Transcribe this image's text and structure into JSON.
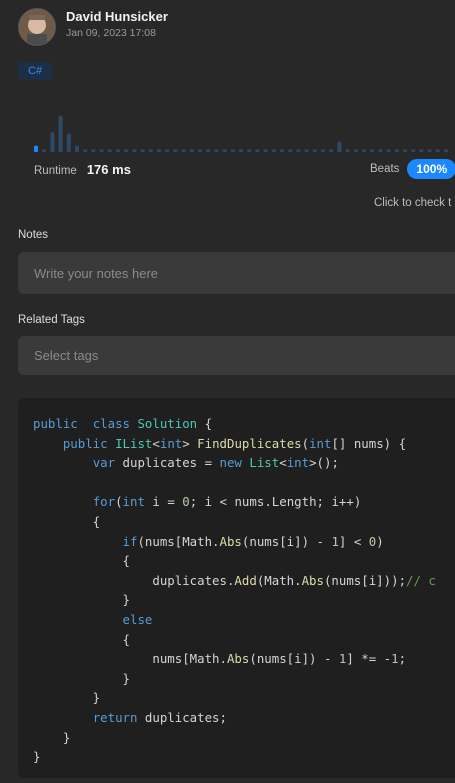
{
  "author": {
    "name": "David Hunsicker",
    "date": "Jan 09, 2023 17:08"
  },
  "language": "C#",
  "histogram": {
    "bar_heights": [
      0.12,
      0.05,
      0.38,
      0.7,
      0.35,
      0.12,
      0.05,
      0.05,
      0.05,
      0.05,
      0.05,
      0.05,
      0.05,
      0.05,
      0.05,
      0.05,
      0.05,
      0.05,
      0.05,
      0.05,
      0.05,
      0.05,
      0.05,
      0.05,
      0.05,
      0.05,
      0.05,
      0.05,
      0.05,
      0.05,
      0.05,
      0.05,
      0.05,
      0.05,
      0.05,
      0.05,
      0.05,
      0.2,
      0.05,
      0.05,
      0.05,
      0.05,
      0.05,
      0.05,
      0.05,
      0.05,
      0.05,
      0.05,
      0.05,
      0.05,
      0.05
    ],
    "highlight_index": 0,
    "colors": {
      "bar": "#2d4968",
      "highlight": "#1a88ff"
    }
  },
  "runtime": {
    "label": "Runtime",
    "value": "176 ms",
    "beats_label": "Beats",
    "beats_value": "100%",
    "click_hint": "Click to check t"
  },
  "notes": {
    "label": "Notes",
    "placeholder": "Write your notes here"
  },
  "tags": {
    "label": "Related Tags",
    "placeholder": "Select tags"
  },
  "code": [
    [
      [
        "kw",
        "public"
      ],
      [
        "",
        "  "
      ],
      [
        "kw",
        "class"
      ],
      [
        "",
        " "
      ],
      [
        "ty",
        "Solution"
      ],
      [
        "",
        " {"
      ]
    ],
    [
      [
        "",
        "    "
      ],
      [
        "kw",
        "public"
      ],
      [
        "",
        " "
      ],
      [
        "ty",
        "IList"
      ],
      [
        "",
        "<"
      ],
      [
        "kw",
        "int"
      ],
      [
        "",
        "> "
      ],
      [
        "fn",
        "FindDuplicates"
      ],
      [
        "",
        "("
      ],
      [
        "kw",
        "int"
      ],
      [
        "",
        "[] nums) {"
      ]
    ],
    [
      [
        "",
        "        "
      ],
      [
        "kw",
        "var"
      ],
      [
        "",
        " duplicates = "
      ],
      [
        "kw",
        "new"
      ],
      [
        "",
        " "
      ],
      [
        "ty",
        "List"
      ],
      [
        "",
        "<"
      ],
      [
        "kw",
        "int"
      ],
      [
        "",
        ">();"
      ]
    ],
    [],
    [
      [
        "",
        "        "
      ],
      [
        "kw",
        "for"
      ],
      [
        "",
        "("
      ],
      [
        "kw",
        "int"
      ],
      [
        "",
        " i = "
      ],
      [
        "num",
        "0"
      ],
      [
        "",
        "; i < nums.Length; i++)"
      ]
    ],
    [
      [
        "",
        "        {"
      ]
    ],
    [
      [
        "",
        "            "
      ],
      [
        "kw",
        "if"
      ],
      [
        "",
        "(nums[Math."
      ],
      [
        "fn",
        "Abs"
      ],
      [
        "",
        "(nums[i]) - "
      ],
      [
        "num",
        "1"
      ],
      [
        "",
        "] < "
      ],
      [
        "num",
        "0"
      ],
      [
        "",
        ")"
      ]
    ],
    [
      [
        "",
        "            {"
      ]
    ],
    [
      [
        "",
        "                duplicates."
      ],
      [
        "fn",
        "Add"
      ],
      [
        "",
        "(Math."
      ],
      [
        "fn",
        "Abs"
      ],
      [
        "",
        "(nums[i]));"
      ],
      [
        "cm",
        "// c"
      ]
    ],
    [
      [
        "",
        "            }"
      ]
    ],
    [
      [
        "",
        "            "
      ],
      [
        "kw",
        "else"
      ]
    ],
    [
      [
        "",
        "            {"
      ]
    ],
    [
      [
        "",
        "                nums[Math."
      ],
      [
        "fn",
        "Abs"
      ],
      [
        "",
        "(nums[i]) - "
      ],
      [
        "num",
        "1"
      ],
      [
        "",
        "] *= -"
      ],
      [
        "num",
        "1"
      ],
      [
        "",
        ";"
      ]
    ],
    [
      [
        "",
        "            }"
      ]
    ],
    [
      [
        "",
        "        }"
      ]
    ],
    [
      [
        "",
        "        "
      ],
      [
        "kw",
        "return"
      ],
      [
        "",
        " duplicates;"
      ]
    ],
    [
      [
        "",
        "    }"
      ]
    ],
    [
      [
        "",
        "}"
      ]
    ]
  ]
}
